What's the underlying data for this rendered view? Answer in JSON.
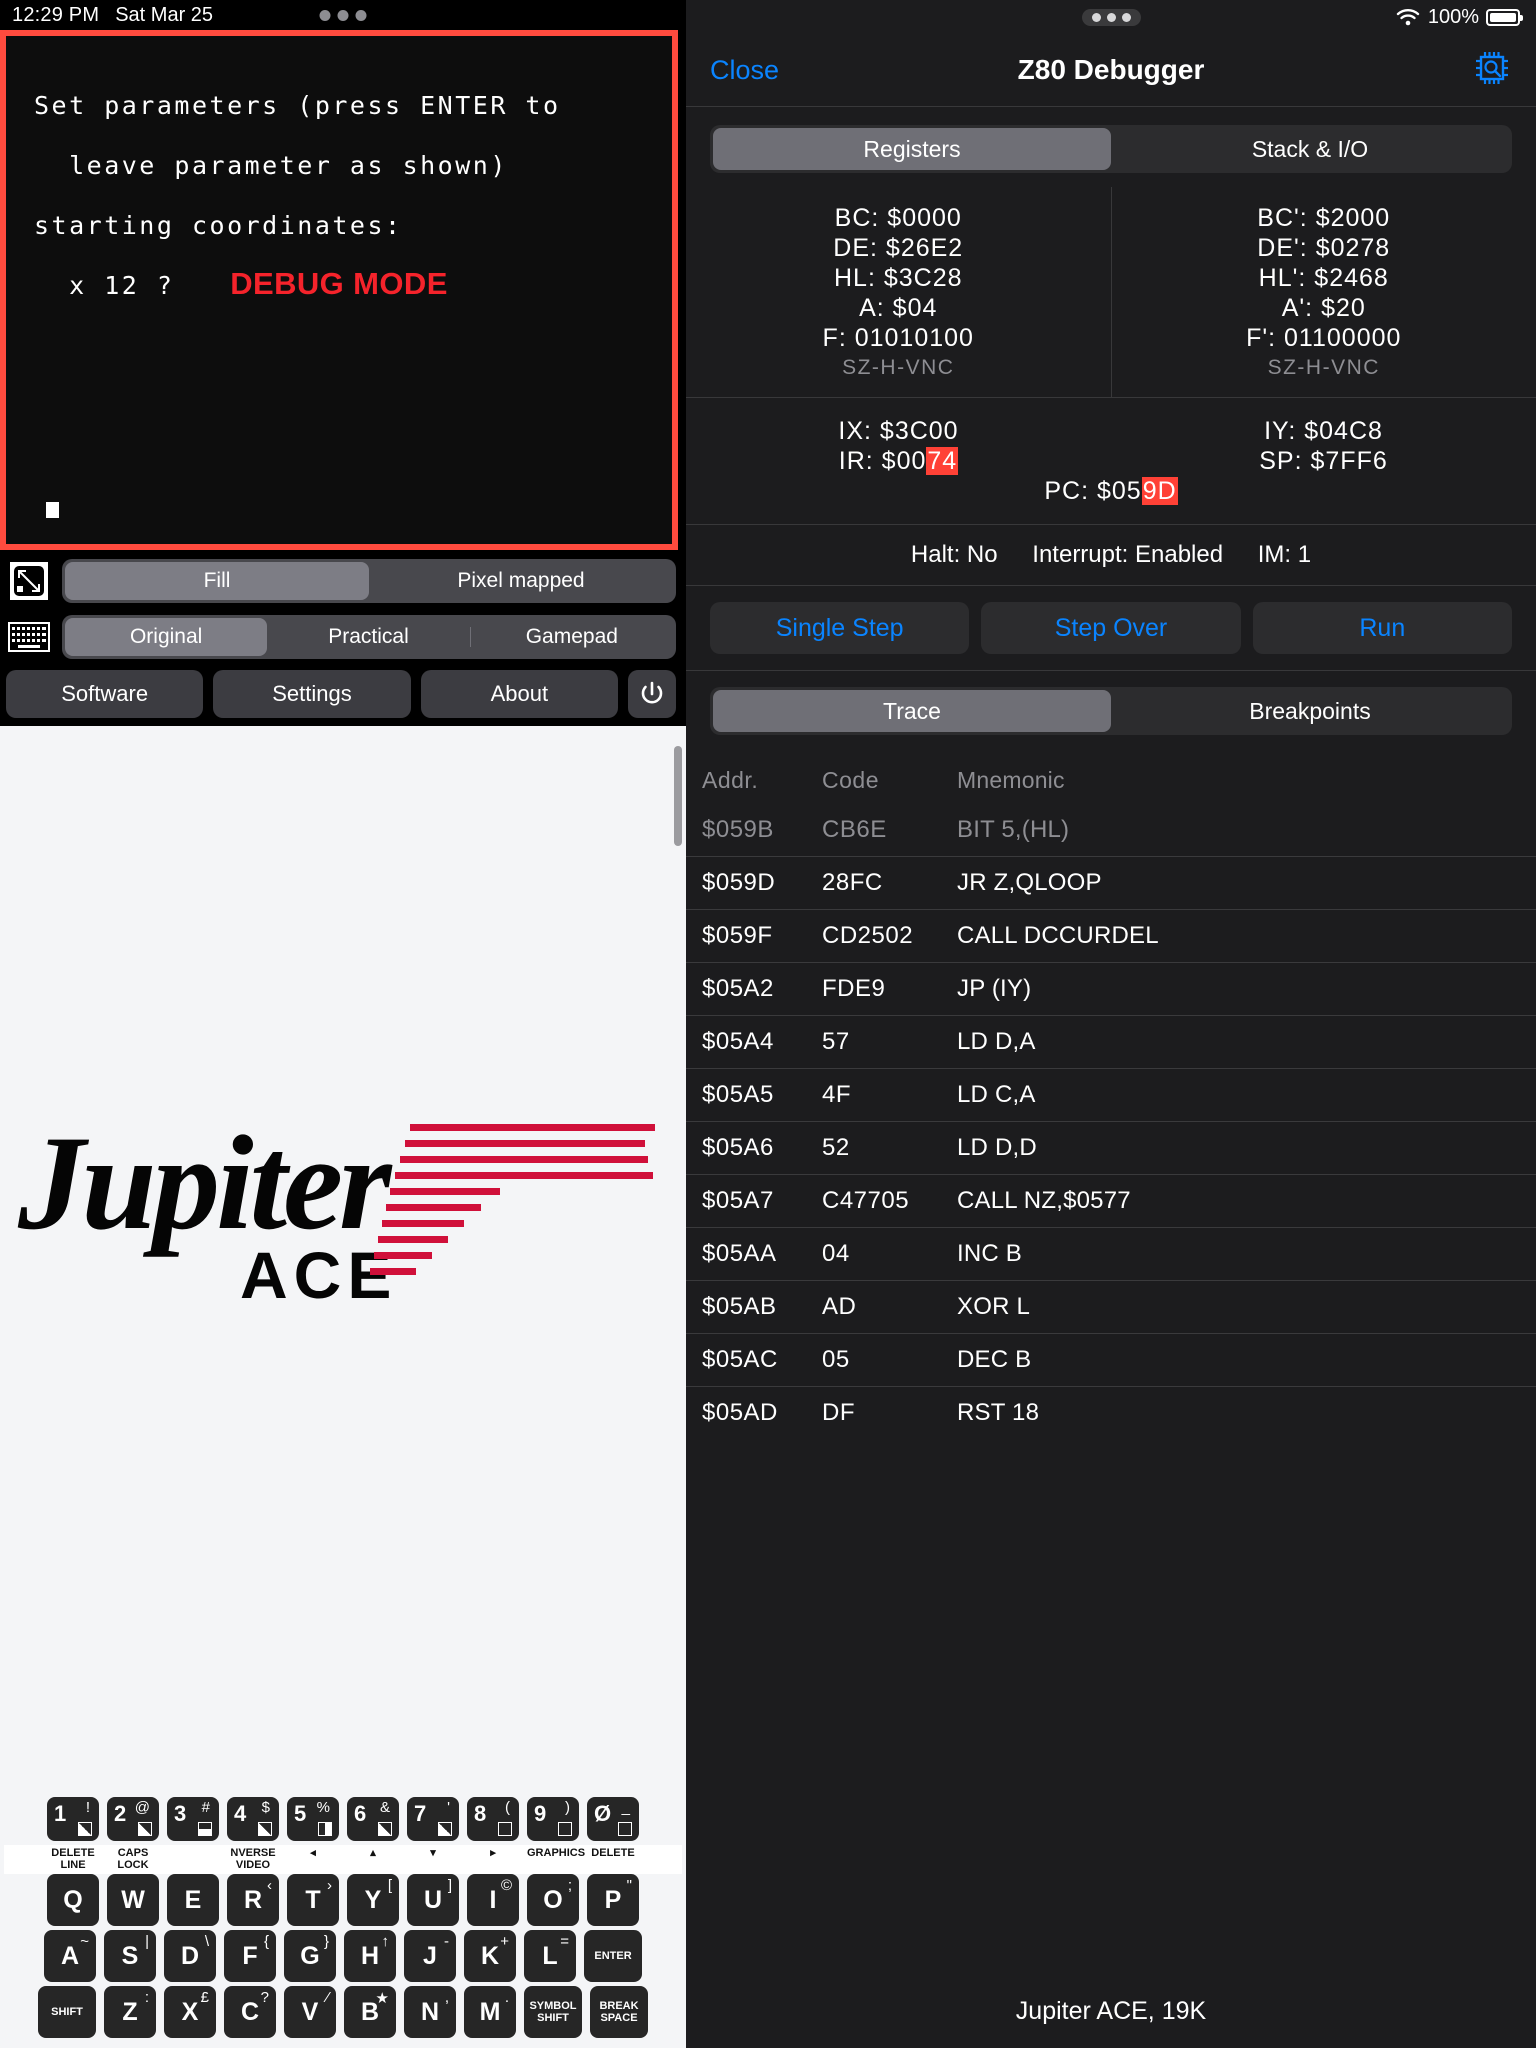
{
  "left": {
    "statusbar": {
      "time": "12:29 PM",
      "date": "Sat Mar 25"
    },
    "emulator": {
      "lines": [
        "Set parameters (press ENTER to",
        "  leave parameter as shown)",
        "starting coordinates:",
        "  x 12 ?"
      ],
      "banner": "DEBUG MODE"
    },
    "display_segment": {
      "options": [
        "Fill",
        "Pixel mapped"
      ],
      "selected": "Fill"
    },
    "keyboard_segment": {
      "options": [
        "Original",
        "Practical",
        "Gamepad"
      ],
      "selected": "Original"
    },
    "buttons": {
      "software": "Software",
      "settings": "Settings",
      "about": "About"
    },
    "logo": {
      "word": "Jupiter",
      "sub": "ACE"
    },
    "keys": {
      "numbers": [
        {
          "main": "1",
          "sup": "!",
          "gfx": "g1"
        },
        {
          "main": "2",
          "sup": "@",
          "gfx": "g1"
        },
        {
          "main": "3",
          "sup": "#",
          "gfx": "g2"
        },
        {
          "main": "4",
          "sup": "$",
          "gfx": "g1"
        },
        {
          "main": "5",
          "sup": "%",
          "gfx": "g3"
        },
        {
          "main": "6",
          "sup": "&",
          "gfx": "g1"
        },
        {
          "main": "7",
          "sup": "'",
          "gfx": "g1"
        },
        {
          "main": "8",
          "sup": "(",
          "gfx": "g0"
        },
        {
          "main": "9",
          "sup": ")",
          "gfx": "g0"
        },
        {
          "main": "Ø",
          "sup": "_",
          "gfx": "g0"
        }
      ],
      "legend": [
        "DELETE LINE",
        "CAPS LOCK",
        "",
        "NVERSE VIDEO",
        "◂",
        "▴",
        "▾",
        "▸",
        "GRAPHICS",
        "DELETE"
      ],
      "row_q": [
        {
          "main": "Q",
          "sup": ""
        },
        {
          "main": "W",
          "sup": ""
        },
        {
          "main": "E",
          "sup": ""
        },
        {
          "main": "R",
          "sup": "‹"
        },
        {
          "main": "T",
          "sup": "›"
        },
        {
          "main": "Y",
          "sup": "["
        },
        {
          "main": "U",
          "sup": "]"
        },
        {
          "main": "I",
          "sup": "©"
        },
        {
          "main": "O",
          "sup": ";"
        },
        {
          "main": "P",
          "sup": "\""
        }
      ],
      "row_a": [
        {
          "main": "A",
          "sup": "~"
        },
        {
          "main": "S",
          "sup": "|"
        },
        {
          "main": "D",
          "sup": "\\"
        },
        {
          "main": "F",
          "sup": "{"
        },
        {
          "main": "G",
          "sup": "}"
        },
        {
          "main": "H",
          "sup": "↑"
        },
        {
          "main": "J",
          "sup": "-"
        },
        {
          "main": "K",
          "sup": "+"
        },
        {
          "main": "L",
          "sup": "="
        }
      ],
      "enter": "ENTER",
      "row_z": [
        {
          "main": "Z",
          "sup": ":"
        },
        {
          "main": "X",
          "sup": "£"
        },
        {
          "main": "C",
          "sup": "?"
        },
        {
          "main": "V",
          "sup": "⁄"
        },
        {
          "main": "B",
          "sup": "★"
        },
        {
          "main": "N",
          "sup": ","
        },
        {
          "main": "M",
          "sup": "."
        }
      ],
      "shift": "SHIFT",
      "symbol_shift": "SYMBOL SHIFT",
      "break_space": "BREAK SPACE"
    }
  },
  "right": {
    "statusbar": {
      "battery_pct": "100%"
    },
    "nav": {
      "close": "Close",
      "title": "Z80 Debugger"
    },
    "top_segment": {
      "options": [
        "Registers",
        "Stack & I/O"
      ],
      "selected": "Registers"
    },
    "registers": {
      "main": [
        {
          "label": "BC:",
          "value": "$0000"
        },
        {
          "label": "DE:",
          "value": "$26E2"
        },
        {
          "label": "HL:",
          "value": "$3C28"
        },
        {
          "label": "A:",
          "value": "$04"
        },
        {
          "label": "F:",
          "value": "01010100"
        }
      ],
      "main_flags": "SZ-H-VNC",
      "alt": [
        {
          "label": "BC':",
          "value": "$2000"
        },
        {
          "label": "DE':",
          "value": "$0278"
        },
        {
          "label": "HL':",
          "value": "$2468"
        },
        {
          "label": "A':",
          "value": "$20"
        },
        {
          "label": "F':",
          "value": "01100000"
        }
      ],
      "alt_flags": "SZ-H-VNC",
      "ix": "IX: $3C00",
      "iy": "IY: $04C8",
      "ir_prefix": "IR: $00",
      "ir_hl": "74",
      "sp": "SP: $7FF6",
      "pc_prefix": "PC: $05",
      "pc_hl": "9D"
    },
    "cpu_status": {
      "halt": "Halt: No",
      "interrupt": "Interrupt: Enabled",
      "im": "IM: 1"
    },
    "controls": {
      "single_step": "Single Step",
      "step_over": "Step Over",
      "run": "Run"
    },
    "bottom_segment": {
      "options": [
        "Trace",
        "Breakpoints"
      ],
      "selected": "Trace"
    },
    "trace": {
      "headers": [
        "Addr.",
        "Code",
        "Mnemonic"
      ],
      "rows": [
        {
          "addr": "$059B",
          "code": "CB6E",
          "mnemonic": "BIT 5,(HL)",
          "dim": true
        },
        {
          "addr": "$059D",
          "code": "28FC",
          "mnemonic": "JR Z,QLOOP",
          "dim": false
        },
        {
          "addr": "$059F",
          "code": "CD2502",
          "mnemonic": "CALL DCCURDEL",
          "dim": false
        },
        {
          "addr": "$05A2",
          "code": "FDE9",
          "mnemonic": "JP (IY)",
          "dim": false
        },
        {
          "addr": "$05A4",
          "code": "57",
          "mnemonic": "LD D,A",
          "dim": false
        },
        {
          "addr": "$05A5",
          "code": "4F",
          "mnemonic": "LD C,A",
          "dim": false
        },
        {
          "addr": "$05A6",
          "code": "52",
          "mnemonic": "LD D,D",
          "dim": false
        },
        {
          "addr": "$05A7",
          "code": "C47705",
          "mnemonic": "CALL NZ,$0577",
          "dim": false
        },
        {
          "addr": "$05AA",
          "code": "04",
          "mnemonic": "INC B",
          "dim": false
        },
        {
          "addr": "$05AB",
          "code": "AD",
          "mnemonic": "XOR L",
          "dim": false
        },
        {
          "addr": "$05AC",
          "code": "05",
          "mnemonic": "DEC B",
          "dim": false
        },
        {
          "addr": "$05AD",
          "code": "DF",
          "mnemonic": "RST 18",
          "dim": false
        }
      ]
    },
    "footer": "Jupiter ACE, 19K"
  },
  "colors": {
    "accent_red": "#ff4b3e",
    "link_blue": "#0a84ff",
    "highlight": "#ff4136"
  }
}
